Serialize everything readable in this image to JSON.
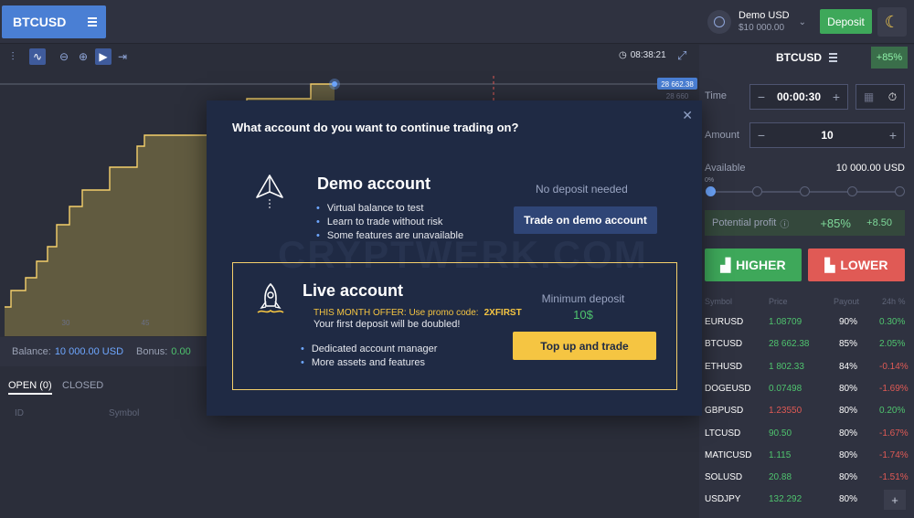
{
  "topbar": {
    "symbol": "BTCUSD",
    "account_name": "Demo USD",
    "account_balance": "$10 000.00",
    "deposit_label": "Deposit"
  },
  "chart_tools": {
    "clock": "08:38:21",
    "price_tag": "28 662.38",
    "price_tag_2": "28 660",
    "xticks": [
      "30",
      "45"
    ]
  },
  "balance_bar": {
    "balance_label": "Balance:",
    "balance_value": "10 000.00 USD",
    "bonus_label": "Bonus:",
    "bonus_value": "0.00"
  },
  "tabs": {
    "open": "OPEN (0)",
    "closed": "CLOSED"
  },
  "columns": {
    "id": "ID",
    "symbol": "Symbol"
  },
  "right_panel": {
    "symbol": "BTCUSD",
    "payout_badge": "+85%",
    "time_label": "Time",
    "time_value": "00:00:30",
    "amount_label": "Amount",
    "amount_value": "10",
    "available_label": "Available",
    "available_value": "10 000.00 USD",
    "slider_min": "0%",
    "profit_label": "Potential profit",
    "profit_pct": "+85%",
    "profit_value": "+8.50",
    "higher_label": "HIGHER",
    "lower_label": "LOWER",
    "market_headers": [
      "Symbol",
      "Price",
      "Payout",
      "24h %"
    ],
    "markets": [
      {
        "symbol": "EURUSD",
        "price": "1.08709",
        "payout": "90%",
        "change": "0.30%",
        "up": true,
        "price_dir": "up"
      },
      {
        "symbol": "BTCUSD",
        "price": "28 662.38",
        "payout": "85%",
        "change": "2.05%",
        "up": true,
        "price_dir": "up"
      },
      {
        "symbol": "ETHUSD",
        "price": "1 802.33",
        "payout": "84%",
        "change": "-0.14%",
        "up": false,
        "price_dir": "up"
      },
      {
        "symbol": "DOGEUSD",
        "price": "0.07498",
        "payout": "80%",
        "change": "-1.69%",
        "up": false,
        "price_dir": "up"
      },
      {
        "symbol": "GBPUSD",
        "price": "1.23550",
        "payout": "80%",
        "change": "0.20%",
        "up": true,
        "price_dir": "dn"
      },
      {
        "symbol": "LTCUSD",
        "price": "90.50",
        "payout": "80%",
        "change": "-1.67%",
        "up": false,
        "price_dir": "up"
      },
      {
        "symbol": "MATICUSD",
        "price": "1.115",
        "payout": "80%",
        "change": "-1.74%",
        "up": false,
        "price_dir": "up"
      },
      {
        "symbol": "SOLUSD",
        "price": "20.88",
        "payout": "80%",
        "change": "-1.51%",
        "up": false,
        "price_dir": "up"
      },
      {
        "symbol": "USDJPY",
        "price": "132.292",
        "payout": "80%",
        "change": "",
        "up": true,
        "price_dir": "up"
      }
    ]
  },
  "modal": {
    "title": "What account do you want to continue trading on?",
    "demo_title": "Demo account",
    "demo_bullets": [
      "Virtual balance to test",
      "Learn to trade without risk",
      "Some features are unavailable"
    ],
    "no_deposit": "No deposit needed",
    "demo_button": "Trade on demo account",
    "live_title": "Live account",
    "offer_text": "THIS MONTH OFFER: Use promo code:",
    "promo_code": "2XFIRST",
    "doubled_text": "Your first deposit will be doubled!",
    "live_bullets": [
      "Dedicated account manager",
      "More assets and features"
    ],
    "min_deposit_label": "Minimum deposit",
    "min_deposit_value": "10$",
    "topup_button": "Top up and trade",
    "watermark": "CRYPTWERK.COM"
  },
  "colors": {
    "accent_blue": "#4a7fd4",
    "green": "#3ea85a",
    "red": "#e05a55",
    "gold": "#f5c542",
    "modal_bg": "#1f2a44"
  },
  "icons": [
    "menu-icon",
    "user-icon",
    "chevron-down-icon",
    "moon-icon",
    "clock-icon",
    "expand-icon",
    "close-icon",
    "paper-plane-icon",
    "rocket-icon",
    "timer-icon",
    "help-icon",
    "chart-up-icon",
    "chart-down-icon",
    "plus-icon"
  ]
}
